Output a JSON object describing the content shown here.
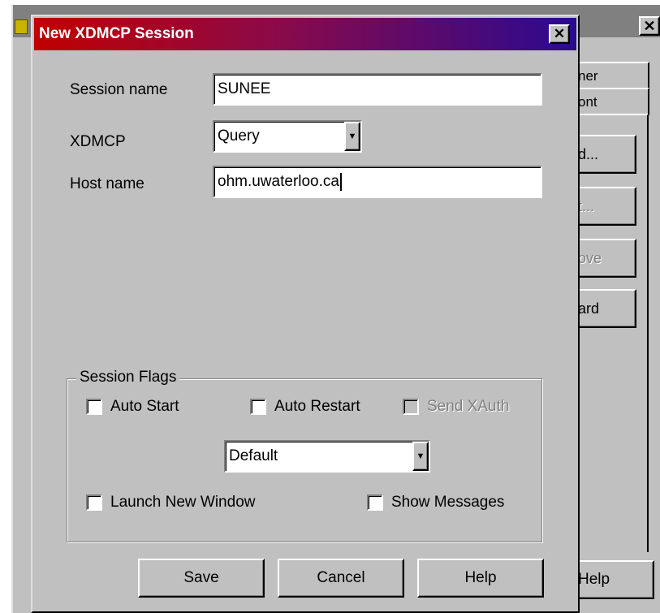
{
  "background_window": {
    "close_glyph": "✕",
    "tabs": [
      "ner",
      "ont"
    ],
    "buttons": [
      "d...",
      "t...",
      "ove",
      "ard"
    ],
    "help_label": "Help"
  },
  "dialog": {
    "title": "New XDMCP Session",
    "close_glyph": "✕",
    "fields": {
      "session_name_label": "Session name",
      "session_name_value": "SUNEE",
      "xdmcp_label": "XDMCP",
      "xdmcp_value": "Query",
      "host_name_label": "Host name",
      "host_name_value": "ohm.uwaterloo.ca"
    },
    "session_flags": {
      "legend": "Session Flags",
      "auto_start": {
        "label": "Auto Start",
        "checked": false
      },
      "auto_restart": {
        "label": "Auto Restart",
        "checked": false
      },
      "send_xauth": {
        "label": "Send XAuth",
        "checked": false,
        "disabled": true
      },
      "mode_value": "Default",
      "launch_new_window": {
        "label": "Launch New Window",
        "checked": false
      },
      "show_messages": {
        "label": "Show Messages",
        "checked": false
      }
    },
    "buttons": {
      "save": "Save",
      "cancel": "Cancel",
      "help": "Help"
    },
    "arrow_glyph": "▼"
  }
}
